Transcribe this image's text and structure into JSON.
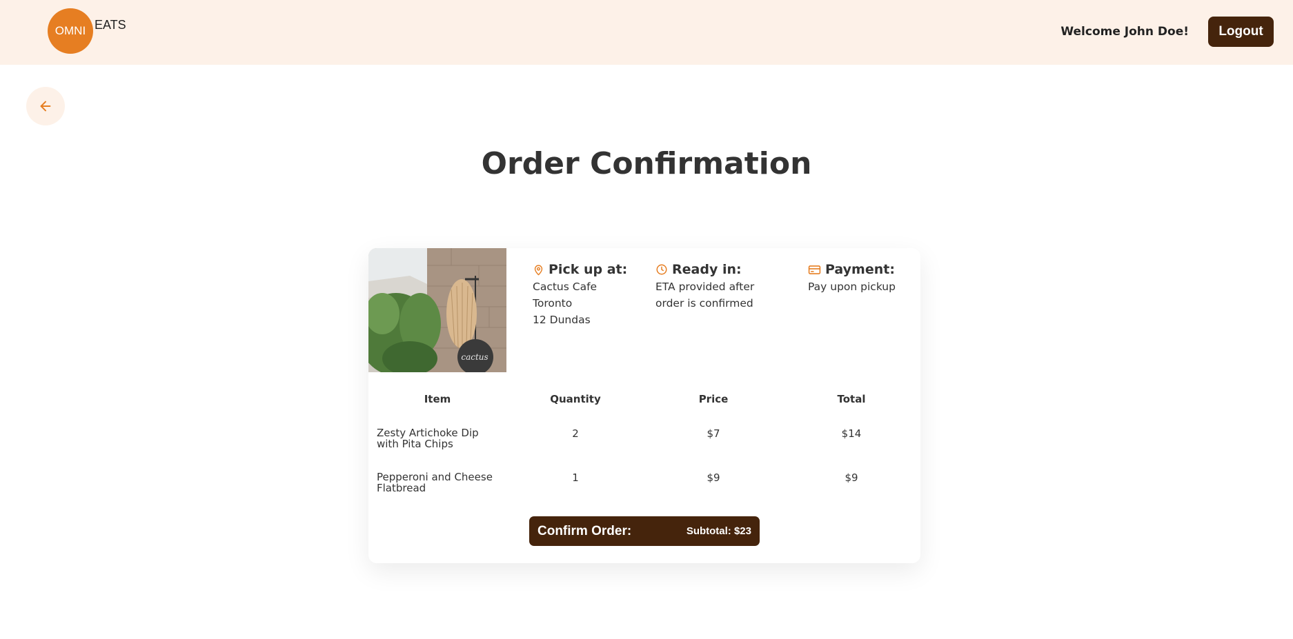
{
  "header": {
    "logo_circle": "OMNI",
    "logo_text": "EATS",
    "welcome": "Welcome John Doe!",
    "logout_label": "Logout"
  },
  "page": {
    "title": "Order Confirmation"
  },
  "order": {
    "pickup": {
      "title": "Pick up at:",
      "lines": [
        "Cactus Cafe",
        "Toronto",
        "12 Dundas"
      ]
    },
    "ready": {
      "title": "Ready in:",
      "lines": [
        "ETA provided after",
        "order is confirmed"
      ]
    },
    "payment": {
      "title": "Payment:",
      "lines": [
        "Pay upon pickup"
      ]
    },
    "columns": [
      "Item",
      "Quantity",
      "Price",
      "Total"
    ],
    "items": [
      {
        "name_lines": [
          "Zesty Artichoke Dip",
          "with Pita Chips"
        ],
        "quantity": "2",
        "price": "$7",
        "total": "$14"
      },
      {
        "name_lines": [
          "Pepperoni and Cheese",
          "Flatbread"
        ],
        "quantity": "1",
        "price": "$9",
        "total": "$9"
      }
    ],
    "confirm_label": "Confirm Order:",
    "subtotal": "Subtotal: $23",
    "sign_text": "cactus"
  },
  "colors": {
    "accent": "#e67e22",
    "dark_brown": "#45240c",
    "header_bg": "#fdf1e8"
  }
}
